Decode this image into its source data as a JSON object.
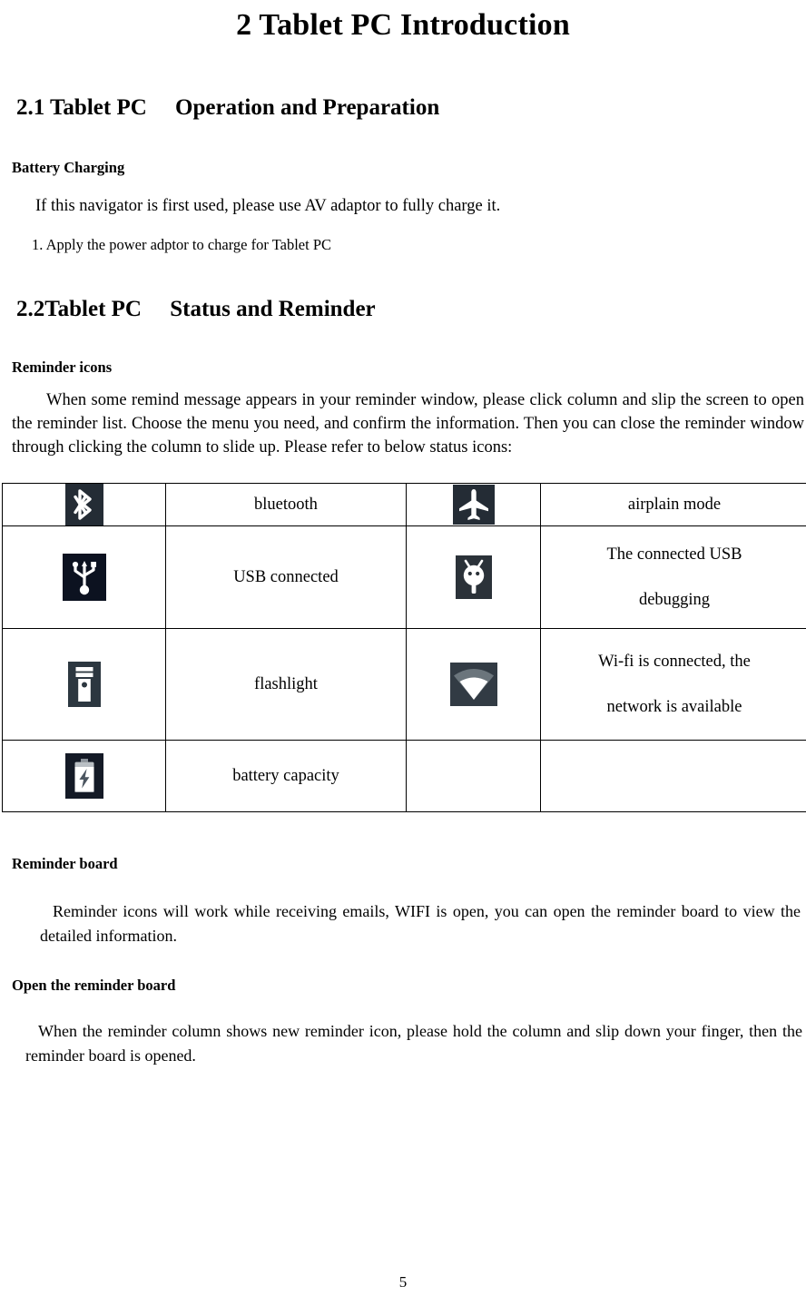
{
  "document": {
    "title": "2 Tablet PC Introduction",
    "page_number": "5"
  },
  "sections": {
    "s21": {
      "heading": "2.1 Tablet PC  Operation and Preparation",
      "subheading": "Battery Charging",
      "para1": "If this navigator is first used, please use AV adaptor to fully charge it.",
      "para2": "1. Apply the power adptor to charge for Tablet PC"
    },
    "s22": {
      "heading": "2.2Tablet PC  Status and Reminder",
      "subheading": "Reminder icons",
      "para1": "When some remind message appears in your reminder window, please click column and slip the screen to open the reminder list. Choose the menu you need, and confirm the information. Then you can close the reminder window through clicking the column to slide up. Please refer to below status icons:"
    },
    "reminder_board": {
      "subheading1": "Reminder board",
      "para1": "Reminder icons will work while receiving emails, WIFI is open, you can open the reminder board to view the detailed information.",
      "subheading2": "Open the reminder board",
      "para2": "When the reminder column shows new reminder icon, please hold the column and slip down your finger, then the reminder board is opened."
    }
  },
  "status_icon_table": {
    "rows": [
      {
        "icon_left": "bluetooth-icon",
        "label_left": "bluetooth",
        "icon_right": "airplane-mode-icon",
        "label_right": "airplain mode"
      },
      {
        "icon_left": "usb-icon",
        "label_left": "USB connected",
        "icon_right": "android-debug-icon",
        "label_right_line1": "The connected USB",
        "label_right_line2": "debugging"
      },
      {
        "icon_left": "flashlight-icon",
        "label_left": "flashlight",
        "icon_right": "wifi-icon",
        "label_right_line1": "Wi-fi is connected, the",
        "label_right_line2": "network is available"
      },
      {
        "icon_left": "battery-icon",
        "label_left": "battery capacity",
        "icon_right": "",
        "label_right": ""
      }
    ]
  },
  "colors": {
    "icon_background": "#242c35",
    "icon_glyph": "#ffffff",
    "text": "#000000",
    "page_background": "#ffffff",
    "table_border": "#000000"
  }
}
